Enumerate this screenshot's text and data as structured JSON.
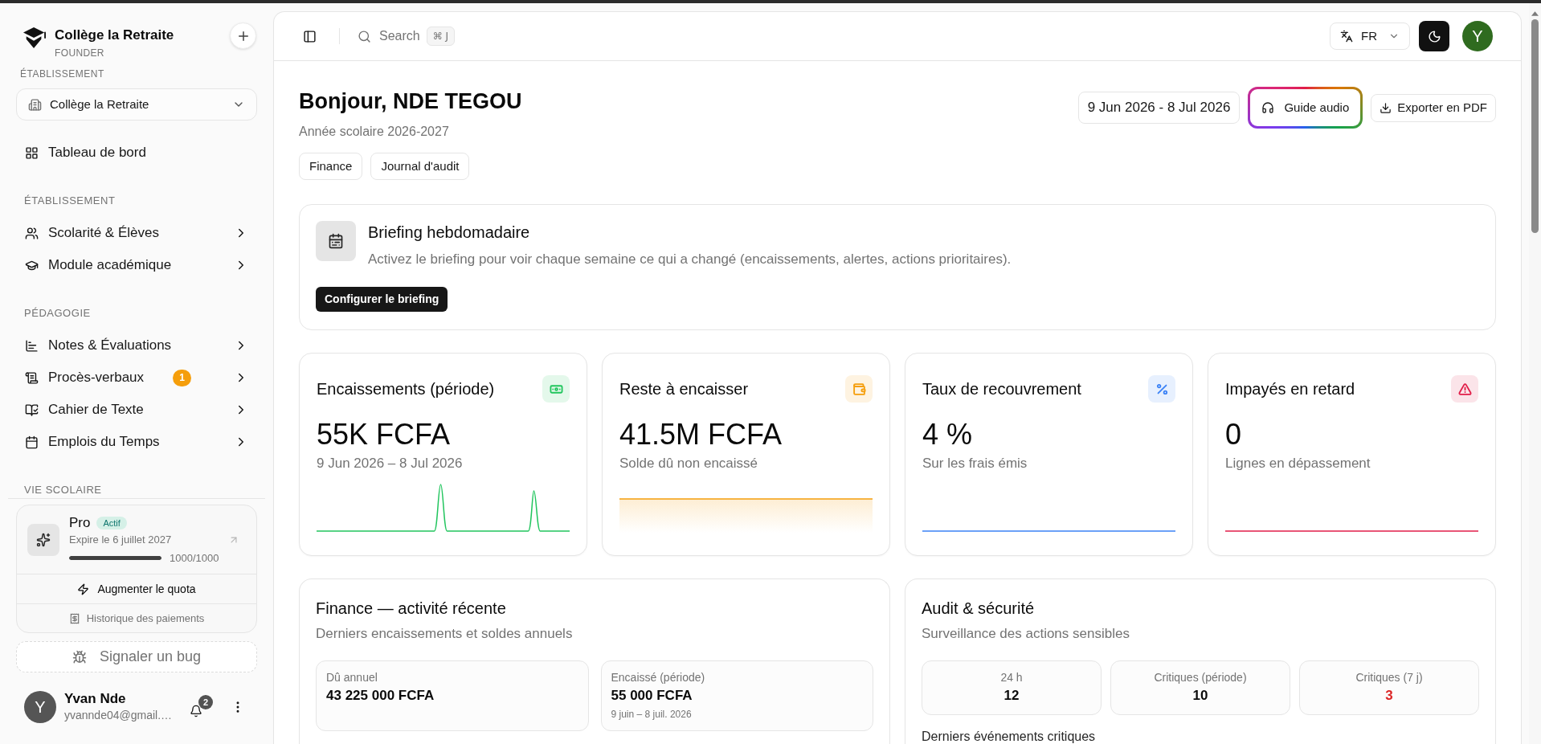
{
  "sidebar": {
    "brand": {
      "name": "Collège la Retraite",
      "role": "FOUNDER"
    },
    "school_label": "ÉTABLISSEMENT",
    "school_select": {
      "value": "Collège la Retraite"
    },
    "home": {
      "label": "Tableau de bord"
    },
    "sections": [
      {
        "title": "ÉTABLISSEMENT",
        "items": [
          {
            "label": "Scolarité & Élèves",
            "expanded": false
          },
          {
            "label": "Module académique",
            "expanded": false
          }
        ]
      },
      {
        "title": "PÉDAGOGIE",
        "items": [
          {
            "label": "Notes & Évaluations",
            "expanded": false
          },
          {
            "label": "Procès-verbaux",
            "badge": "1",
            "expanded": false
          },
          {
            "label": "Cahier de Texte",
            "expanded": false
          },
          {
            "label": "Emplois du Temps",
            "expanded": false
          }
        ]
      },
      {
        "title": "VIE SCOLAIRE"
      }
    ],
    "plan": {
      "name": "Pro",
      "status": "Actif",
      "expiry": "Expire le 6 juillet 2027",
      "level": 1,
      "quota": "1000/1000",
      "upgrade": "Augmenter le quota",
      "history": "Historique des paiements"
    },
    "bug_report": "Signaler un bug",
    "user": {
      "initial": "Y",
      "name": "Yvan Nde",
      "email": "yvannde04@gmail.…",
      "notifications": "2"
    }
  },
  "header": {
    "search": {
      "label": "Search",
      "shortcut": "⌘ J"
    },
    "language": "FR",
    "avatar_initial": "Y"
  },
  "greeting": {
    "title": "Bonjour, NDE TEGOU",
    "subtitle": "Année scolaire 2026-2027",
    "links": [
      "Finance",
      "Journal d'audit"
    ],
    "date_range": "9 Jun 2026 - 8 Jul 2026",
    "audio_guide": "Guide audio",
    "export": "Exporter en PDF"
  },
  "briefing": {
    "title": "Briefing hebdomadaire",
    "description": "Activez le briefing pour voir chaque semaine ce qui a changé (encaissements, alertes, actions prioritaires).",
    "button": "Configurer le briefing"
  },
  "kpis": [
    {
      "title": "Encaissements (période)",
      "value": "55K FCFA",
      "subtitle": "9 Jun 2026 – 8 Jul 2026",
      "color": "#22c55e",
      "kind": "spikes"
    },
    {
      "title": "Reste à encaisser",
      "value": "41.5M FCFA",
      "subtitle": "Solde dû non encaissé",
      "color": "#f59e0b",
      "kind": "area"
    },
    {
      "title": "Taux de recouvrement",
      "value": "4 %",
      "subtitle": "Sur les frais émis",
      "color": "#3b82f6",
      "kind": "flat"
    },
    {
      "title": "Impayés en retard",
      "value": "0",
      "subtitle": "Lignes en dépassement",
      "color": "#e11d48",
      "kind": "flat"
    }
  ],
  "finance": {
    "title": "Finance — activité récente",
    "subtitle": "Derniers encaissements et soldes annuels",
    "stats": [
      {
        "label": "Dû annuel",
        "value": "43 225 000 FCFA"
      },
      {
        "label": "Encaissé (période)",
        "value": "55 000 FCFA",
        "note": "9 juin – 8 juil. 2026"
      }
    ]
  },
  "audit": {
    "title": "Audit & sécurité",
    "subtitle": "Surveillance des actions sensibles",
    "stats": [
      {
        "label": "24 h",
        "value": "12",
        "critical": false
      },
      {
        "label": "Critiques (période)",
        "value": "10",
        "critical": false
      },
      {
        "label": "Critiques (7 j)",
        "value": "3",
        "critical": true
      }
    ],
    "events_label": "Derniers événements critiques"
  }
}
